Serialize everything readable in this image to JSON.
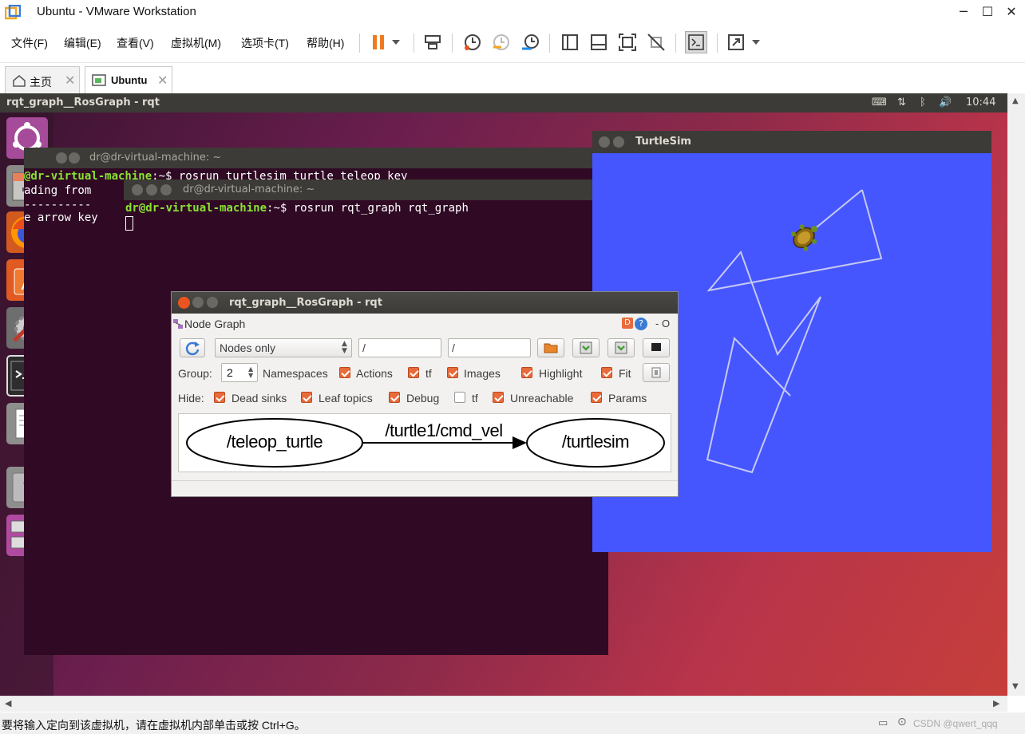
{
  "window": {
    "title": "Ubuntu - VMware Workstation",
    "minimize": "─",
    "maximize": "☐",
    "close": "✕"
  },
  "menu": [
    "文件(F)",
    "编辑(E)",
    "查看(V)",
    "虚拟机(M)",
    "选项卡(T)",
    "帮助(H)"
  ],
  "toolbar": {
    "icons": [
      "pause-icon",
      "dropdown-icon",
      "send-ctrl-alt-del-icon",
      "snapshot-icon",
      "revert-snapshot-icon",
      "snapshot-manager-icon",
      "show-library-icon",
      "thumbnail-bar-icon",
      "full-screen-icon",
      "unity-icon",
      "console-view-icon",
      "stretch-icon"
    ]
  },
  "tabs": [
    {
      "label": "主页",
      "active": false
    },
    {
      "label": "Ubuntu",
      "active": true
    }
  ],
  "ubuntu": {
    "top_title": "rqt_graph__RosGraph - rqt",
    "clock": "10:44",
    "launcher": [
      "ubuntu-icon",
      "files-icon",
      "firefox-icon",
      "software-center-icon",
      "settings-icon",
      "terminal-icon",
      "text-editor-icon",
      "help-icon",
      "workspace-icon"
    ]
  },
  "term1": {
    "title": "dr@dr-virtual-machine: ~",
    "line1_user": "@dr-virtual-machine",
    "line1_dir": ":~$",
    "line1_cmd": " rosrun turtlesim turtle_teleop_key",
    "line2": "ading from",
    "line3": "----------",
    "line4": "e arrow key"
  },
  "term2": {
    "title": "dr@dr-virtual-machine: ~",
    "user": "dr@dr-virtual-machine",
    "dir": ":~$",
    "cmd": " rosrun rqt_graph rqt_graph"
  },
  "rqt": {
    "title": "rqt_graph__RosGraph - rqt",
    "plugin_title": "Node Graph",
    "plugin_ctrls": "- O",
    "mode": "Nodes only",
    "filter1": "/",
    "filter2": "/",
    "group_label": "Group:",
    "group_value": "2",
    "row1": [
      {
        "label": "Namespaces",
        "checked": true
      },
      {
        "label": "Actions",
        "checked": true
      },
      {
        "label": "tf",
        "checked": true
      },
      {
        "label": "Images",
        "checked": true
      },
      {
        "label": "Highlight",
        "checked": true
      },
      {
        "label": "Fit",
        "checked": true
      }
    ],
    "hide_label": "Hide:",
    "row2": [
      {
        "label": "Dead sinks",
        "checked": true
      },
      {
        "label": "Leaf topics",
        "checked": true
      },
      {
        "label": "Debug",
        "checked": true
      },
      {
        "label": "tf",
        "checked": false
      },
      {
        "label": "Unreachable",
        "checked": true
      },
      {
        "label": "Params",
        "checked": true
      }
    ],
    "graph": {
      "node1": "/teleop_turtle",
      "edge": "/turtle1/cmd_vel",
      "node2": "/turtlesim"
    }
  },
  "turtlesim": {
    "title": "TurtleSim",
    "background": "#4556ff"
  },
  "status": {
    "message": "要将输入定向到该虚拟机，请在虚拟机内部单击或按 Ctrl+G。",
    "watermark": "CSDN @qwert_qqq"
  }
}
